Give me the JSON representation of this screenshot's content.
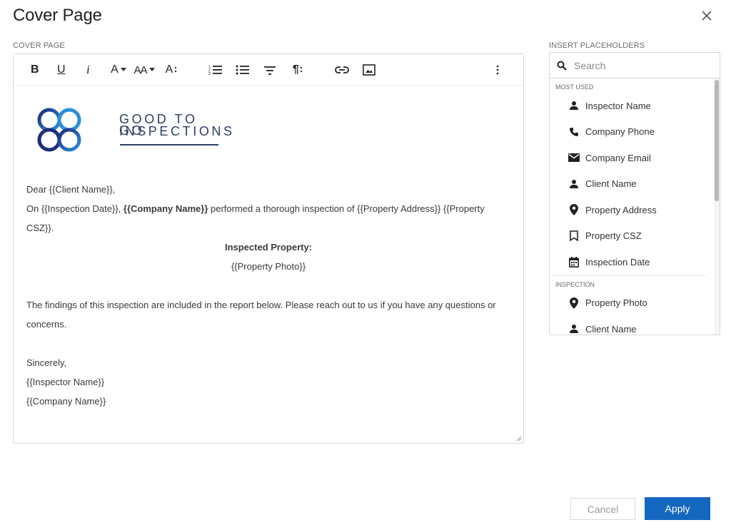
{
  "dialog": {
    "title": "Cover Page",
    "close_icon": "close-icon"
  },
  "editor_section": {
    "label": "COVER PAGE",
    "toolbar": {
      "bold": "B",
      "underline": "U",
      "italic": "i",
      "font_color": "A",
      "font_size": "AA",
      "font_style": "A"
    },
    "logo": {
      "line1": "GOOD TO GO",
      "line2": "INSPECTIONS"
    },
    "content": {
      "greeting": "Dear {{Client Name}},",
      "line1_a": "On {{Inspection Date}}, ",
      "line1_b": "{{Company Name}}",
      "line1_c": " performed a thorough inspection of {{Property Address}} {{Property",
      "line2": "CSZ}}.",
      "inspected_property": "Inspected Property:",
      "property_photo": "{{Property Photo}}",
      "findings1": "The findings of this inspection are included in the report below.  Please reach out to us if you have any questions or",
      "findings2": "concerns.",
      "sincerely": "Sincerely,",
      "inspector": "{{Inspector Name}}",
      "company": "{{Company Name}}"
    }
  },
  "placeholders": {
    "label": "INSERT PLACEHOLDERS",
    "search_placeholder": "Search",
    "groups": [
      {
        "name": "MOST USED",
        "items": [
          {
            "label": "Inspector Name",
            "icon": "person-icon"
          },
          {
            "label": "Company Phone",
            "icon": "phone-icon"
          },
          {
            "label": "Company Email",
            "icon": "email-icon"
          },
          {
            "label": "Client Name",
            "icon": "person-icon"
          },
          {
            "label": "Property Address",
            "icon": "location-pin-icon"
          },
          {
            "label": "Property CSZ",
            "icon": "bookmark-icon"
          },
          {
            "label": "Inspection Date",
            "icon": "calendar-icon"
          }
        ]
      },
      {
        "name": "INSPECTION",
        "items": [
          {
            "label": "Property Photo",
            "icon": "location-pin-icon"
          },
          {
            "label": "Client Name",
            "icon": "person-icon"
          }
        ]
      }
    ]
  },
  "footer": {
    "cancel": "Cancel",
    "apply": "Apply"
  },
  "colors": {
    "accent": "#1467bf",
    "logo_navy": "#2c3e63",
    "logo_blue": "#2b8fd9"
  }
}
